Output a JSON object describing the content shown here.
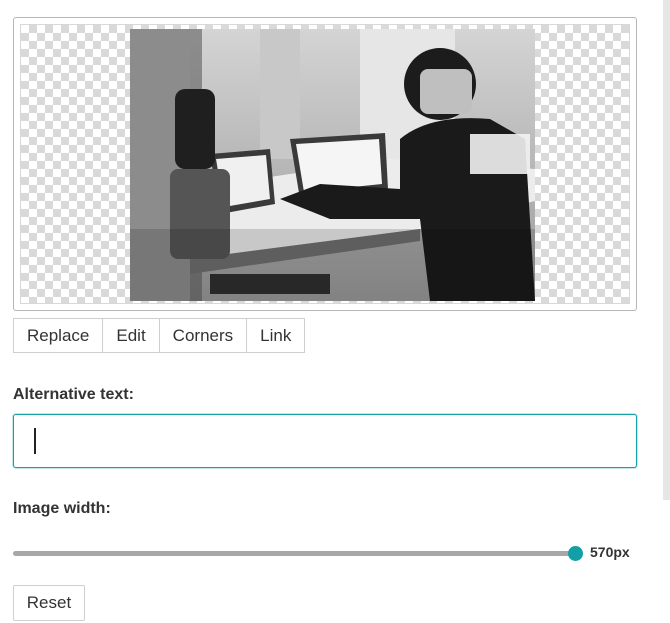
{
  "toolbar": {
    "replace_label": "Replace",
    "edit_label": "Edit",
    "corners_label": "Corners",
    "link_label": "Link"
  },
  "alt_text": {
    "label": "Alternative text:",
    "value": ""
  },
  "image_width": {
    "label": "Image width:",
    "value_label": "570px",
    "slider_fraction": 1.0
  },
  "reset_label": "Reset",
  "colors": {
    "accent": "#12a0a6",
    "border": "#cfcfcf",
    "text": "#333333"
  }
}
